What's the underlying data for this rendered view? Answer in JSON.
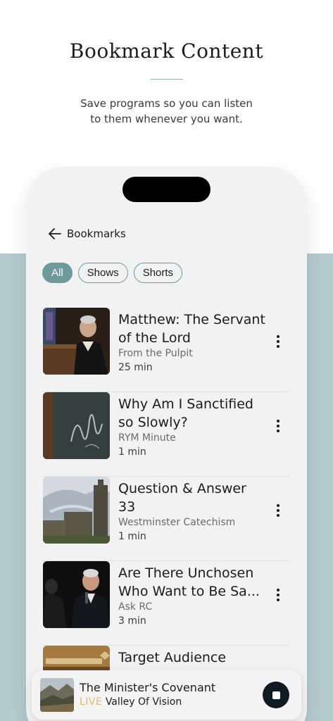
{
  "promo": {
    "title": "Bookmark Content",
    "subtitle_line1": "Save programs so you can listen",
    "subtitle_line2": "to them whenever you want."
  },
  "header": {
    "back_icon": "arrow-left-icon",
    "title": "Bookmarks"
  },
  "filters": [
    {
      "label": "All",
      "active": true
    },
    {
      "label": "Shows",
      "active": false
    },
    {
      "label": "Shorts",
      "active": false
    }
  ],
  "bookmarks": [
    {
      "title": "Matthew: The Servant of the Lord",
      "show": "From the Pulpit",
      "duration": "25 min"
    },
    {
      "title": "Why Am I Sanctified so Slowly?",
      "show": "RYM Minute",
      "duration": "1 min"
    },
    {
      "title": "Question & Answer 33",
      "show": "Westminster Catechism",
      "duration": "1 min"
    },
    {
      "title": "Are There Unchosen Who Want to Be Sa...",
      "show": "Ask RC",
      "duration": "3 min"
    },
    {
      "title": "Target Audience",
      "show": "",
      "duration": ""
    }
  ],
  "player": {
    "title": "The Minister's Covenant",
    "live_label": "LIVE",
    "show": "Valley Of Vision",
    "stop_icon": "stop-icon"
  },
  "colors": {
    "accent": "#6e9a9d",
    "background_band": "#b5cbcf",
    "live": "#e3b86b"
  }
}
